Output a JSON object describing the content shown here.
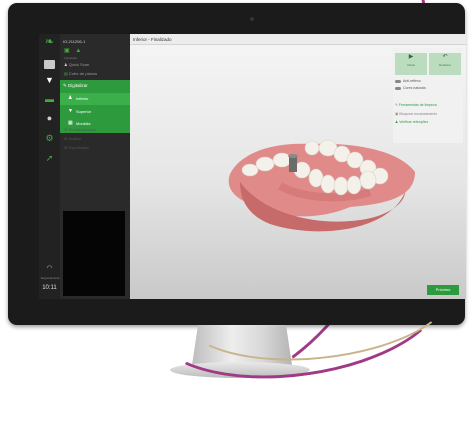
{
  "colors": {
    "accent_green": "#2e9a3e",
    "sidebar_bg": "#2a2a2a",
    "gum_pink": "#e08a8a",
    "deco_purple": "#a03a86",
    "deco_gold": "#c8b48a"
  },
  "icons": {
    "logo": "leaf-logo-icon",
    "scan": "scan-icon",
    "tooth": "tooth-icon",
    "chat": "chat-icon",
    "settings": "gear-icon",
    "export": "arrow-icon",
    "wifi": "wifi-icon"
  },
  "iconbar": {
    "date": "Segunda-feira",
    "time": "10:11"
  },
  "sidebar": {
    "case_id": "IO-211206-1",
    "section_label": "Aquisição",
    "quick_scan": "Quick Scan",
    "color_label": "Cofre de planos",
    "digitize": "Digitalizar",
    "inferior": "Inferior",
    "superior": "Superior",
    "mordida": "Mordida",
    "processamento": "Processamento",
    "analise": "Análise",
    "exportacao": "Exportação"
  },
  "main": {
    "title": "Inferior - Finalizado"
  },
  "right_panel": {
    "scan_btn_label": "Iniciar",
    "undo_btn_label": "Desfazer",
    "toggle1": "Anti-reflexo",
    "toggle2": "Cores naturais",
    "link1": "Ferramentas de limpeza",
    "link2": "Bloquear escaneamento",
    "link3": "Verificar retenções"
  },
  "footer": {
    "next_label": "Próximo"
  }
}
